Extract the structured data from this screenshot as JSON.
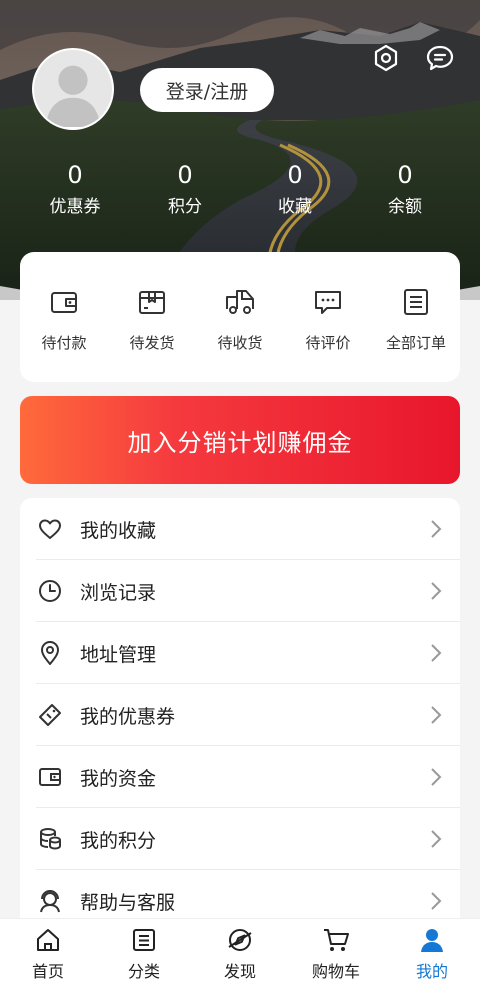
{
  "header": {
    "login_label": "登录/注册",
    "stats": [
      {
        "value": "0",
        "label": "优惠券"
      },
      {
        "value": "0",
        "label": "积分"
      },
      {
        "value": "0",
        "label": "收藏"
      },
      {
        "value": "0",
        "label": "余额"
      }
    ]
  },
  "orders": [
    {
      "label": "待付款",
      "icon": "wallet-icon"
    },
    {
      "label": "待发货",
      "icon": "package-icon"
    },
    {
      "label": "待收货",
      "icon": "truck-icon"
    },
    {
      "label": "待评价",
      "icon": "comment-icon"
    },
    {
      "label": "全部订单",
      "icon": "order-list-icon"
    }
  ],
  "banner": {
    "label": "加入分销计划赚佣金"
  },
  "menu": [
    {
      "label": "我的收藏",
      "icon": "heart-icon"
    },
    {
      "label": "浏览记录",
      "icon": "clock-icon"
    },
    {
      "label": "地址管理",
      "icon": "location-pin-icon"
    },
    {
      "label": "我的优惠券",
      "icon": "coupon-icon"
    },
    {
      "label": "我的资金",
      "icon": "wallet-icon"
    },
    {
      "label": "我的积分",
      "icon": "coins-icon"
    },
    {
      "label": "帮助与客服",
      "icon": "customer-service-icon"
    }
  ],
  "tabs": [
    {
      "label": "首页",
      "icon": "home-icon"
    },
    {
      "label": "分类",
      "icon": "category-icon"
    },
    {
      "label": "发现",
      "icon": "discover-icon"
    },
    {
      "label": "购物车",
      "icon": "cart-icon"
    },
    {
      "label": "我的",
      "icon": "user-icon",
      "active": true
    }
  ],
  "colors": {
    "accent": "#1478d4",
    "banner_start": "#ff6a3c",
    "banner_end": "#e8162c"
  }
}
